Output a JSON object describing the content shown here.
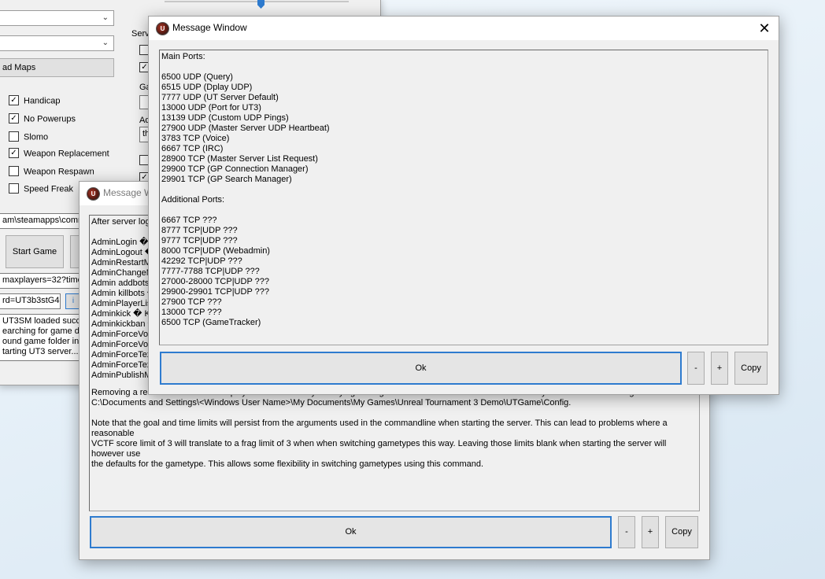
{
  "main_window": {
    "load_maps_label": "ad Maps",
    "server_group_label": "Serv",
    "game_label_partial": "Ga",
    "admin_label_partial": "Ad",
    "admin_field_partial": "th",
    "checkboxes": [
      {
        "label": "Handicap",
        "checked": "✓"
      },
      {
        "label": "No Powerups",
        "checked": "✓"
      },
      {
        "label": "Slomo",
        "checked": ""
      },
      {
        "label": "Weapon Replacement",
        "checked": "✓"
      },
      {
        "label": "Weapon Respawn",
        "checked": ""
      },
      {
        "label": "Speed Freak",
        "checked": ""
      }
    ],
    "path_field": "am\\steamapps\\comm",
    "start_game_label": "Start Game",
    "cmdline_field": "maxplayers=32?timelin",
    "password_field": "rd=UT3b3stG4m",
    "log_lines": "UT3SM loaded succes\nearching for game dir\nound game folder in S\ntarting UT3 server..."
  },
  "message_window_2": {
    "title": "Message W",
    "content_top": "After server logi\n\nAdminLogin � L\nAdminLogout �\nAdminRestartM\nAdminChangeM\nAdmin addbots\nAdmin killbots �\nAdminPlayerList\nAdminkick � Ki\nAdminkickban �\nAdminForceVoi\nAdminForceVoi\nAdminForceTex\nAdminForceTex\nAdminPublishM",
    "content_bottom": "Removing a restriction on a banned player can be done by modifying the utgame.ini file for the server. This is stored by default in the following location:\nC:\\Documents and Settings\\<Windows User Name>\\My Documents\\My Games\\Unreal Tournament 3 Demo\\UTGame\\Config.\n\nNote that the goal and time limits will persist from the arguments used in the commandline when starting the server. This can lead to problems where a reasonable\nVCTF score limit of 3 will translate to a frag limit of 3 when when switching gametypes this way. Leaving those limits blank when starting the server will however use\nthe defaults for the gametype. This allows some flexibility in switching gametypes using this command.",
    "ok_label": "Ok",
    "minus_label": "-",
    "plus_label": "+",
    "copy_label": "Copy"
  },
  "message_window_1": {
    "title": "Message Window",
    "close_label": "✕",
    "icon_label": "U",
    "content": "Main Ports:\n\n6500 UDP (Query)\n6515 UDP (Dplay UDP)\n7777 UDP (UT Server Default)\n13000 UDP (Port for UT3)\n13139 UDP (Custom UDP Pings)\n27900 UDP (Master Server UDP Heartbeat)\n3783 TCP (Voice)\n6667 TCP (IRC)\n28900 TCP (Master Server List Request)\n29900 TCP (GP Connection Manager)\n29901 TCP (GP Search Manager)\n\nAdditional Ports:\n\n6667 TCP ???\n8777 TCP|UDP ???\n9777 TCP|UDP ???\n8000 TCP|UDP (Webadmin)\n42292 TCP|UDP ???\n7777-7788 TCP|UDP ???\n27000-28000 TCP|UDP ???\n29900-29901 TCP|UDP ???\n27900 TCP ???\n13000 TCP ???\n6500 TCP (GameTracker)",
    "ok_label": "Ok",
    "minus_label": "-",
    "plus_label": "+",
    "copy_label": "Copy"
  }
}
